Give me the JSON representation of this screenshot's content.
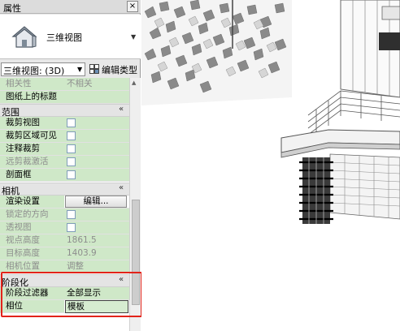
{
  "panel": {
    "title": "属性",
    "close_label": "×",
    "type_name": "三维视图",
    "view_selector": "三维视图: (3D)",
    "edit_type_label": "编辑类型"
  },
  "rows": {
    "dependency": {
      "label": "相关性",
      "value": "不相关"
    },
    "sheet_title": {
      "label": "图纸上的标题",
      "value": ""
    },
    "extents_header": "范围",
    "crop_view": {
      "label": "裁剪视图"
    },
    "crop_region_visible": {
      "label": "裁剪区域可见"
    },
    "annotation_crop": {
      "label": "注释裁剪"
    },
    "far_clip_active": {
      "label": "远剪裁激活"
    },
    "section_box": {
      "label": "剖面框"
    },
    "camera_header": "相机",
    "render_settings": {
      "label": "渲染设置",
      "button": "编辑..."
    },
    "locked_orientation": {
      "label": "锁定的方向"
    },
    "perspective": {
      "label": "透视图"
    },
    "eye_elevation": {
      "label": "视点高度",
      "value": "1861.5"
    },
    "target_elevation": {
      "label": "目标高度",
      "value": "1403.9"
    },
    "camera_position": {
      "label": "相机位置",
      "value": "调整"
    },
    "phasing_header": "阶段化",
    "phase_filter": {
      "label": "阶段过滤器",
      "value": "全部显示"
    },
    "phase": {
      "label": "相位",
      "value": "模板"
    }
  },
  "collapse_glyph": "«",
  "colors": {
    "instance_param_bg": "#cfe8c8",
    "highlight_border": "#e2231a",
    "viewport_bg": "#ffffff"
  }
}
